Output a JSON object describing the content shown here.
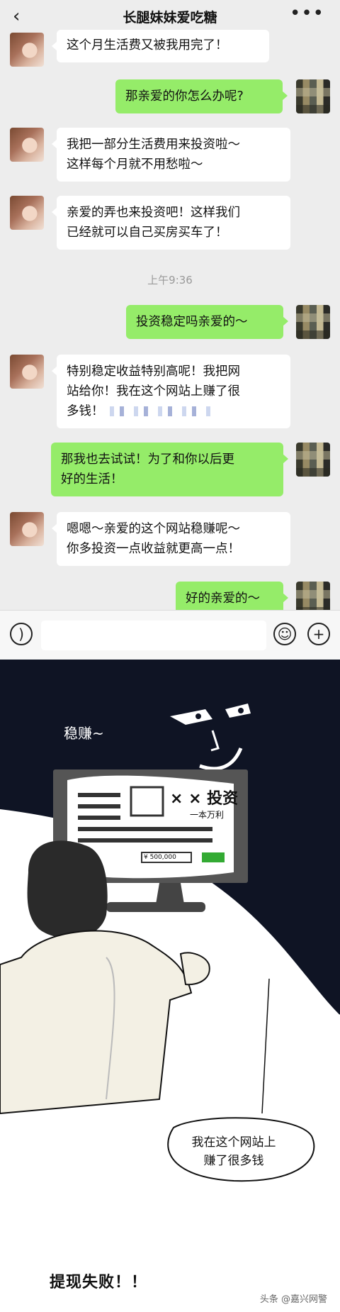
{
  "topbar": {
    "back_icon": "chevron-left-icon",
    "title": "长腿妹妹爱吃糖",
    "more_icon": "more-icon"
  },
  "messages": [
    {
      "side": "left",
      "text": "这个月生活费又被我用完了！"
    },
    {
      "side": "right",
      "text": "那亲爱的你怎么办呢?"
    },
    {
      "side": "left",
      "line1": "我把一部分生活费用来投资啦～",
      "line2": "这样每个月就不用愁啦～"
    },
    {
      "side": "left",
      "line1": "亲爱的弄也来投资吧！这样我们",
      "line2": "已经就可以自己买房买车了！"
    },
    {
      "side": "right",
      "text": "投资稳定吗亲爱的～"
    },
    {
      "side": "left",
      "line1": "特别稳定收益特别高呢！我把网",
      "line2": "站给你！我在这个网站上赚了很",
      "line3": "多钱！"
    },
    {
      "side": "right",
      "line1": "那我也去试试！为了和你以后更",
      "line2": "好的生活！"
    },
    {
      "side": "left",
      "line1": "嗯嗯～亲爱的这个网站稳赚呢～",
      "line2": "你多投资一点收益就更高一点！"
    },
    {
      "side": "right",
      "text": "好的亲爱的～"
    }
  ],
  "timestamp": "上午9:36",
  "inputbar": {
    "voice_icon": "voice-icon",
    "emoji_icon": "emoji-icon",
    "plus_icon": "plus-icon"
  },
  "comic": {
    "caption_top": "稳赚~",
    "screen_title": "× × 投资",
    "screen_sub": "一本万利",
    "screen_amount": "¥ 500,000",
    "speech_line1": "我在这个网站上",
    "speech_line2": "赚了很多钱",
    "caption_bottom": "提现失败！！",
    "watermark": "头条 @嘉兴网警"
  }
}
